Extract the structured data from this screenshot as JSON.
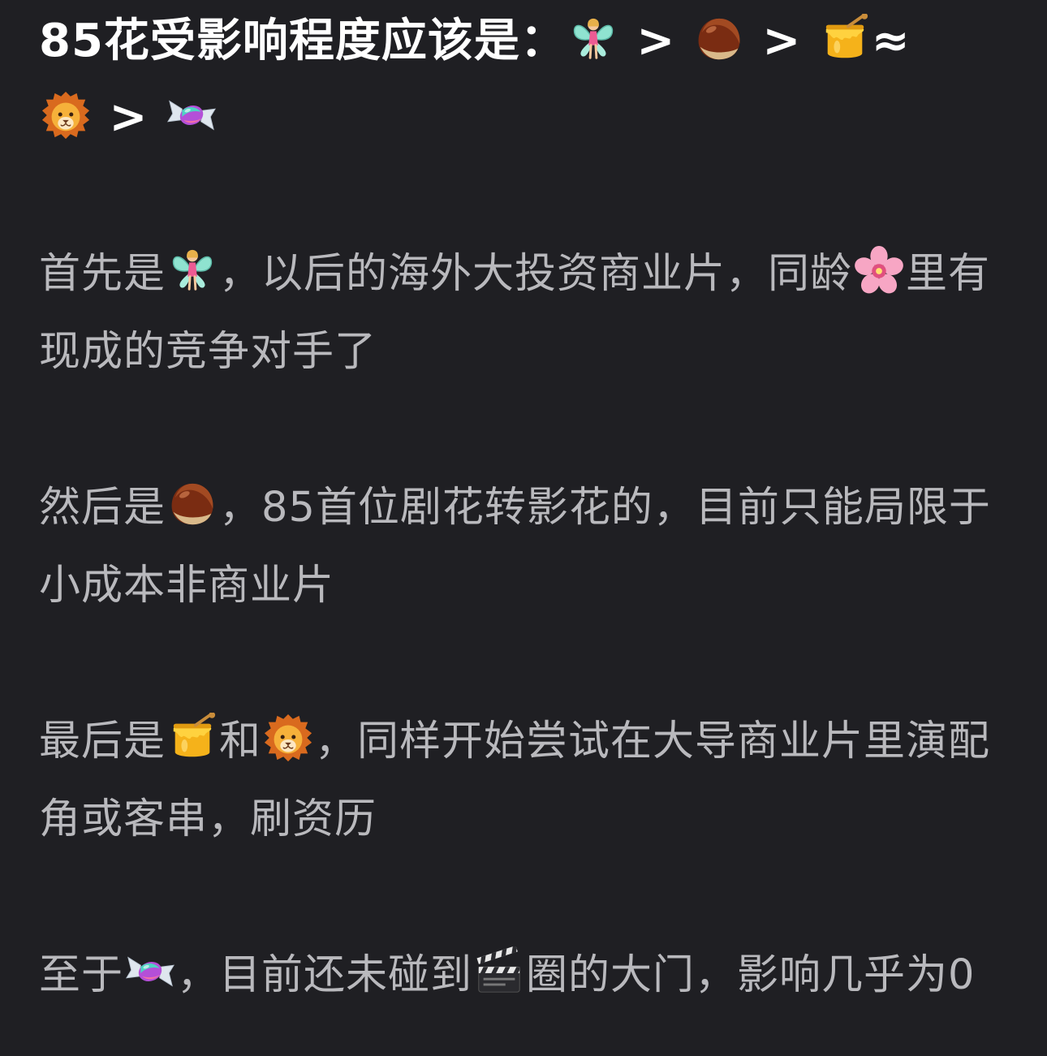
{
  "post": {
    "title": {
      "t1": "85花受影响程度应该是：",
      "t2": " > ",
      "t3": " > ",
      "t4": "≈",
      "t5": " > "
    },
    "p1": {
      "a": "首先是",
      "b": "，以后的海外大投资商业片，同龄",
      "c": "里有现成的竞争对手了"
    },
    "p2": {
      "a": "然后是",
      "b": "，85首位剧花转影花的，目前只能局限于小成本非商业片"
    },
    "p3": {
      "a": "最后是",
      "b": "和",
      "c": "，同样开始尝试在大导商业片里演配角或客串，刷资历"
    },
    "p4": {
      "a": "至于",
      "b": "，目前还未碰到",
      "c": "圈的大门，影响几乎为0"
    }
  },
  "emoji": {
    "fairy": "fairy-icon",
    "chestnut": "chestnut-icon",
    "honey": "honey-pot-icon",
    "lion": "lion-icon",
    "candy": "candy-icon",
    "blossom": "cherry-blossom-icon",
    "clapper": "clapper-board-icon"
  },
  "colors": {
    "background": "#1f1f23",
    "title": "#ffffff",
    "body_text": "#b9b9bd"
  }
}
